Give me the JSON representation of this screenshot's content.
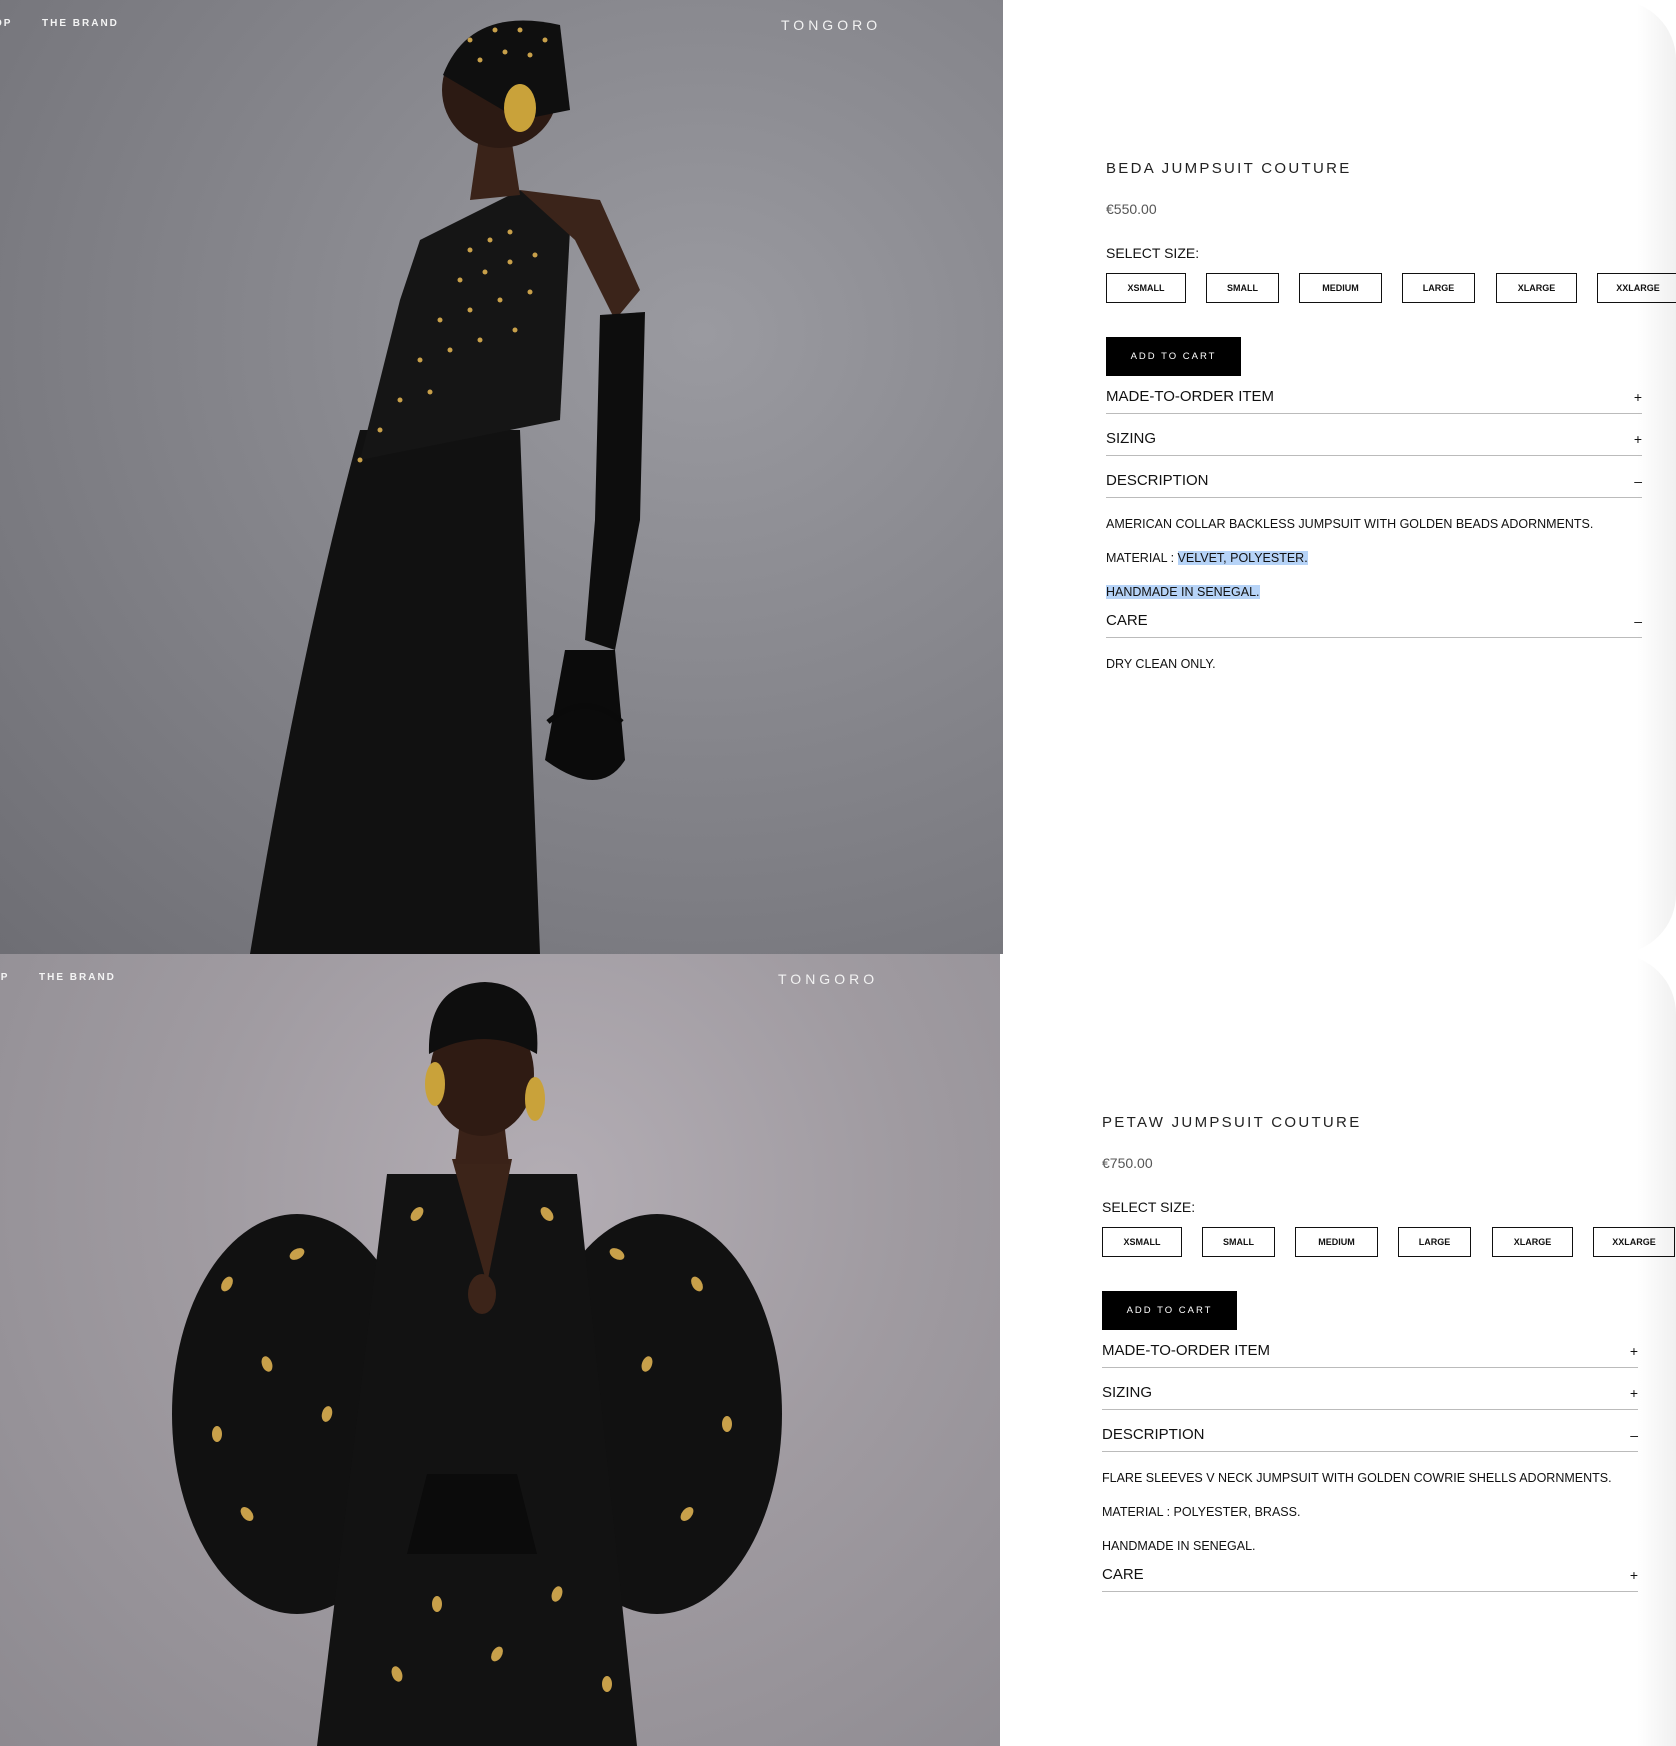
{
  "panels": [
    {
      "nav": {
        "shop": "OP",
        "brand": "THE BRAND",
        "logo": "TONGORO"
      },
      "product": {
        "title": "BEDA JUMPSUIT COUTURE",
        "price": "€550.00",
        "select_size_label": "SELECT SIZE:",
        "sizes": [
          "XSMALL",
          "SMALL",
          "MEDIUM",
          "LARGE",
          "XLARGE",
          "XXLARGE"
        ],
        "add_to_cart": "ADD TO CART",
        "made_to_order": {
          "label": "MADE-TO-ORDER ITEM",
          "sign": "+"
        },
        "sizing": {
          "label": "SIZING",
          "sign": "+"
        },
        "description": {
          "label": "DESCRIPTION",
          "sign": "–",
          "text": "AMERICAN COLLAR BACKLESS JUMPSUIT WITH GOLDEN BEADS ADORNMENTS.",
          "material_prefix": "MATERIAL : ",
          "material_value": "VELVET, POLYESTER.",
          "origin": "HANDMADE IN SENEGAL."
        },
        "care": {
          "label": "CARE",
          "sign": "–",
          "text": "DRY CLEAN ONLY."
        }
      }
    },
    {
      "nav": {
        "shop": "OP",
        "brand": "THE BRAND",
        "logo": "TONGORO"
      },
      "product": {
        "title": "PETAW JUMPSUIT COUTURE",
        "price": "€750.00",
        "select_size_label": "SELECT SIZE:",
        "sizes": [
          "XSMALL",
          "SMALL",
          "MEDIUM",
          "LARGE",
          "XLARGE",
          "XXLARGE"
        ],
        "add_to_cart": "ADD TO CART",
        "made_to_order": {
          "label": "MADE-TO-ORDER ITEM",
          "sign": "+"
        },
        "sizing": {
          "label": "SIZING",
          "sign": "+"
        },
        "description": {
          "label": "DESCRIPTION",
          "sign": "–",
          "text": "FLARE SLEEVES V NECK JUMPSUIT WITH GOLDEN COWRIE SHELLS ADORNMENTS.",
          "material_prefix": "MATERIAL : ",
          "material_value": "POLYESTER, BRASS.",
          "origin": "HANDMADE IN SENEGAL."
        },
        "care": {
          "label": "CARE",
          "sign": "+"
        }
      }
    }
  ],
  "colors": {
    "highlight": "#b6d3f7",
    "button": "#000000",
    "photo_bg": "#86868c"
  }
}
